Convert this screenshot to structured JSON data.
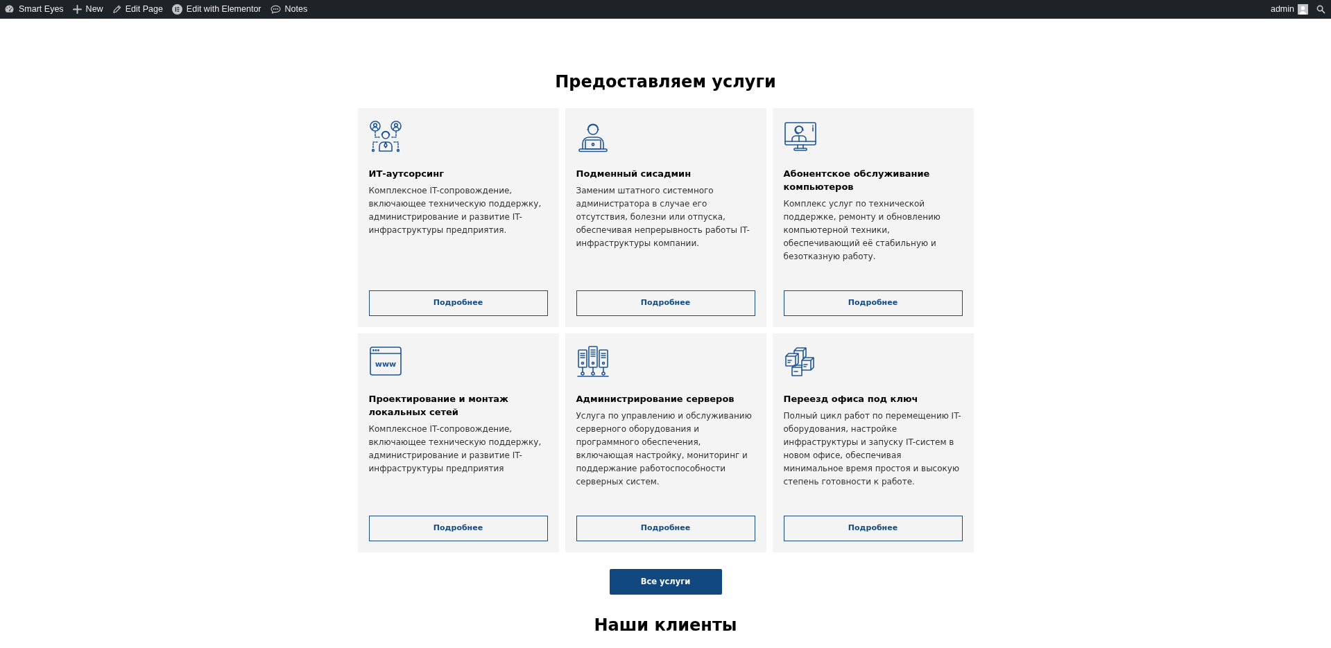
{
  "admin_bar": {
    "items": [
      {
        "kind": "site",
        "label": "Smart Eyes"
      },
      {
        "kind": "new",
        "label": "New"
      },
      {
        "kind": "edit",
        "label": "Edit Page"
      },
      {
        "kind": "elementor",
        "label": "Edit with Elementor"
      },
      {
        "kind": "notes",
        "label": "Notes"
      }
    ],
    "user": {
      "name": "admin"
    }
  },
  "services": {
    "title": "Предоставляем услуги",
    "cards": [
      {
        "kind": "people",
        "title": "ИТ-аутсорсинг",
        "description": "Комплексное IT-сопровождение, включающее техническую поддержку, администрирование и развитие IT-инфраструктуры предприятия.",
        "button": "Подробнее"
      },
      {
        "kind": "laptop",
        "title": "Подменный сисадмин",
        "description": "Заменим штатного системного администратора в случае его отсутствия, болезни или отпуска, обеспечивая непрерывность работы IT-инфраструктуры компании.",
        "button": "Подробнее"
      },
      {
        "kind": "monitor",
        "title": "Абонентское обслуживание компьютеров",
        "description": "Комплекс услуг по технической поддержке, ремонту и обновлению компьютерной техники, обеспечивающий её стабильную и безотказную работу.",
        "button": "Подробнее"
      },
      {
        "kind": "browser",
        "icon_label": "www",
        "title": "Проектирование и монтаж локальных сетей",
        "description": "Комплексное IT-сопровождение, включающее техническую поддержку, администрирование и развитие IT-инфраструктуры предприятия",
        "button": "Подробнее"
      },
      {
        "kind": "servers",
        "title": "Администрирование серверов",
        "description": "Услуга по управлению и обслуживанию серверного оборудования и программного обеспечения, включающая настройку, мониторинг и поддержание работоспособности серверных систем.",
        "button": "Подробнее"
      },
      {
        "kind": "boxes",
        "title": "Переезд офиса под ключ",
        "description": "Полный цикл работ по перемещению IT-оборудования, настройке инфраструктуры и запуску IT-систем в новом офисе, обеспечивая минимальное время простоя и высокую степень готовности к работе.",
        "button": "Подробнее"
      }
    ],
    "all_button": "Все услуги"
  },
  "next_section": {
    "title": "Наши клиенты"
  }
}
